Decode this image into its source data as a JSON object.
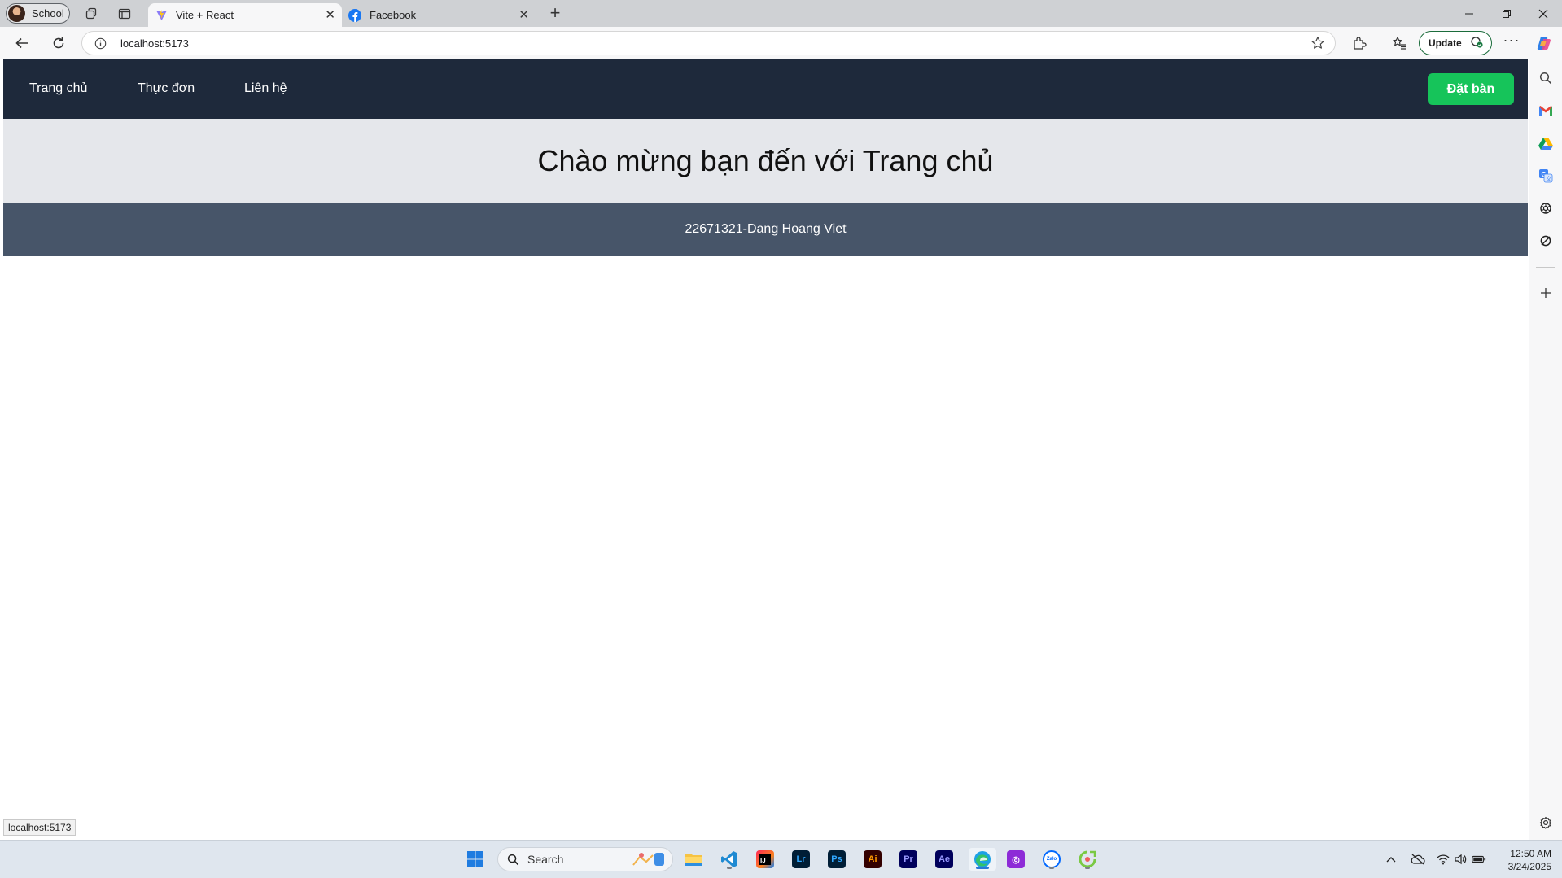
{
  "browser": {
    "profile_label": "School",
    "tabs": [
      {
        "title": "Vite + React",
        "active": true,
        "favicon": "vite-icon"
      },
      {
        "title": "Facebook",
        "active": false,
        "favicon": "facebook-icon"
      }
    ],
    "address": "localhost:5173",
    "update_label": "Update",
    "status_url": "localhost:5173"
  },
  "page": {
    "nav": {
      "links": [
        "Trang chủ",
        "Thực đơn",
        "Liên hệ"
      ],
      "cta_label": "Đặt bàn"
    },
    "hero_title": "Chào mừng bạn đến với Trang chủ",
    "footer_text": "22671321-Dang Hoang Viet",
    "colors": {
      "nav_bg": "#1e293b",
      "cta_bg": "#16c45a",
      "hero_bg": "#e5e7eb",
      "footer_bg": "#475569"
    }
  },
  "taskbar": {
    "search_placeholder": "Search",
    "time": "12:50 AM",
    "date": "3/24/2025",
    "apps": [
      {
        "name": "file-explorer-icon",
        "label": ""
      },
      {
        "name": "vscode-icon",
        "label": ""
      },
      {
        "name": "intellij-icon",
        "label": ""
      },
      {
        "name": "lightroom-icon",
        "label": "Lr"
      },
      {
        "name": "photoshop-icon",
        "label": "Ps"
      },
      {
        "name": "illustrator-icon",
        "label": "Ai"
      },
      {
        "name": "premiere-icon",
        "label": "Pr"
      },
      {
        "name": "after-effects-icon",
        "label": "Ae"
      },
      {
        "name": "edge-icon",
        "label": ""
      },
      {
        "name": "app-icon",
        "label": ""
      },
      {
        "name": "zalo-icon",
        "label": "Zalo"
      },
      {
        "name": "app-green-icon",
        "label": ""
      }
    ]
  }
}
